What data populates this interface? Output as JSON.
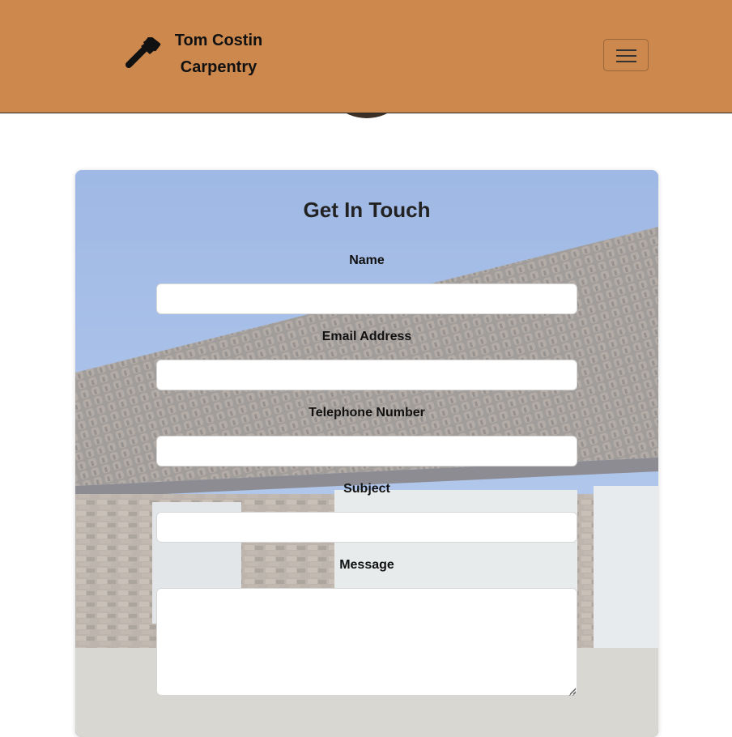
{
  "navbar": {
    "brand_line1": "Tom Costin",
    "brand_line2": "Carpentry",
    "brand_icon": "hammer-icon",
    "menu_icon": "hamburger-menu-icon",
    "background_color": "#cc884d"
  },
  "form": {
    "title": "Get In Touch",
    "fields": [
      {
        "label": "Name",
        "value": "",
        "type": "text"
      },
      {
        "label": "Email Address",
        "value": "",
        "type": "email"
      },
      {
        "label": "Telephone Number",
        "value": "",
        "type": "tel"
      },
      {
        "label": "Subject",
        "value": "",
        "type": "text"
      },
      {
        "label": "Message",
        "value": "",
        "type": "textarea"
      }
    ]
  }
}
